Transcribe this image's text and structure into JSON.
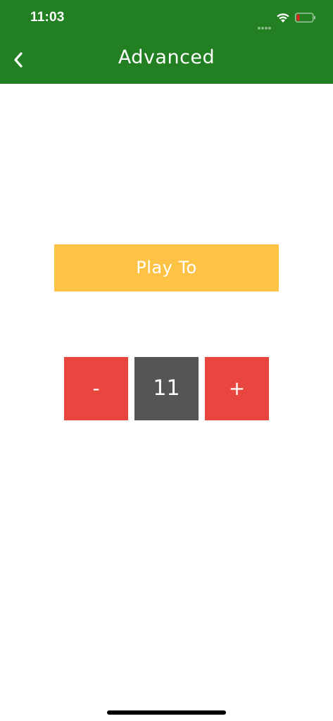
{
  "status_bar": {
    "time": "11:03",
    "icons": [
      "signal-dots-icon",
      "wifi-icon",
      "battery-low-icon"
    ]
  },
  "header": {
    "title": "Advanced",
    "back_icon": "chevron-left-icon",
    "background_color": "#228023"
  },
  "play_to": {
    "label": "Play To",
    "color": "#fec245"
  },
  "stepper": {
    "decrement_label": "-",
    "value": "11",
    "increment_label": "+",
    "button_color": "#e9463f",
    "value_color": "#555555"
  }
}
